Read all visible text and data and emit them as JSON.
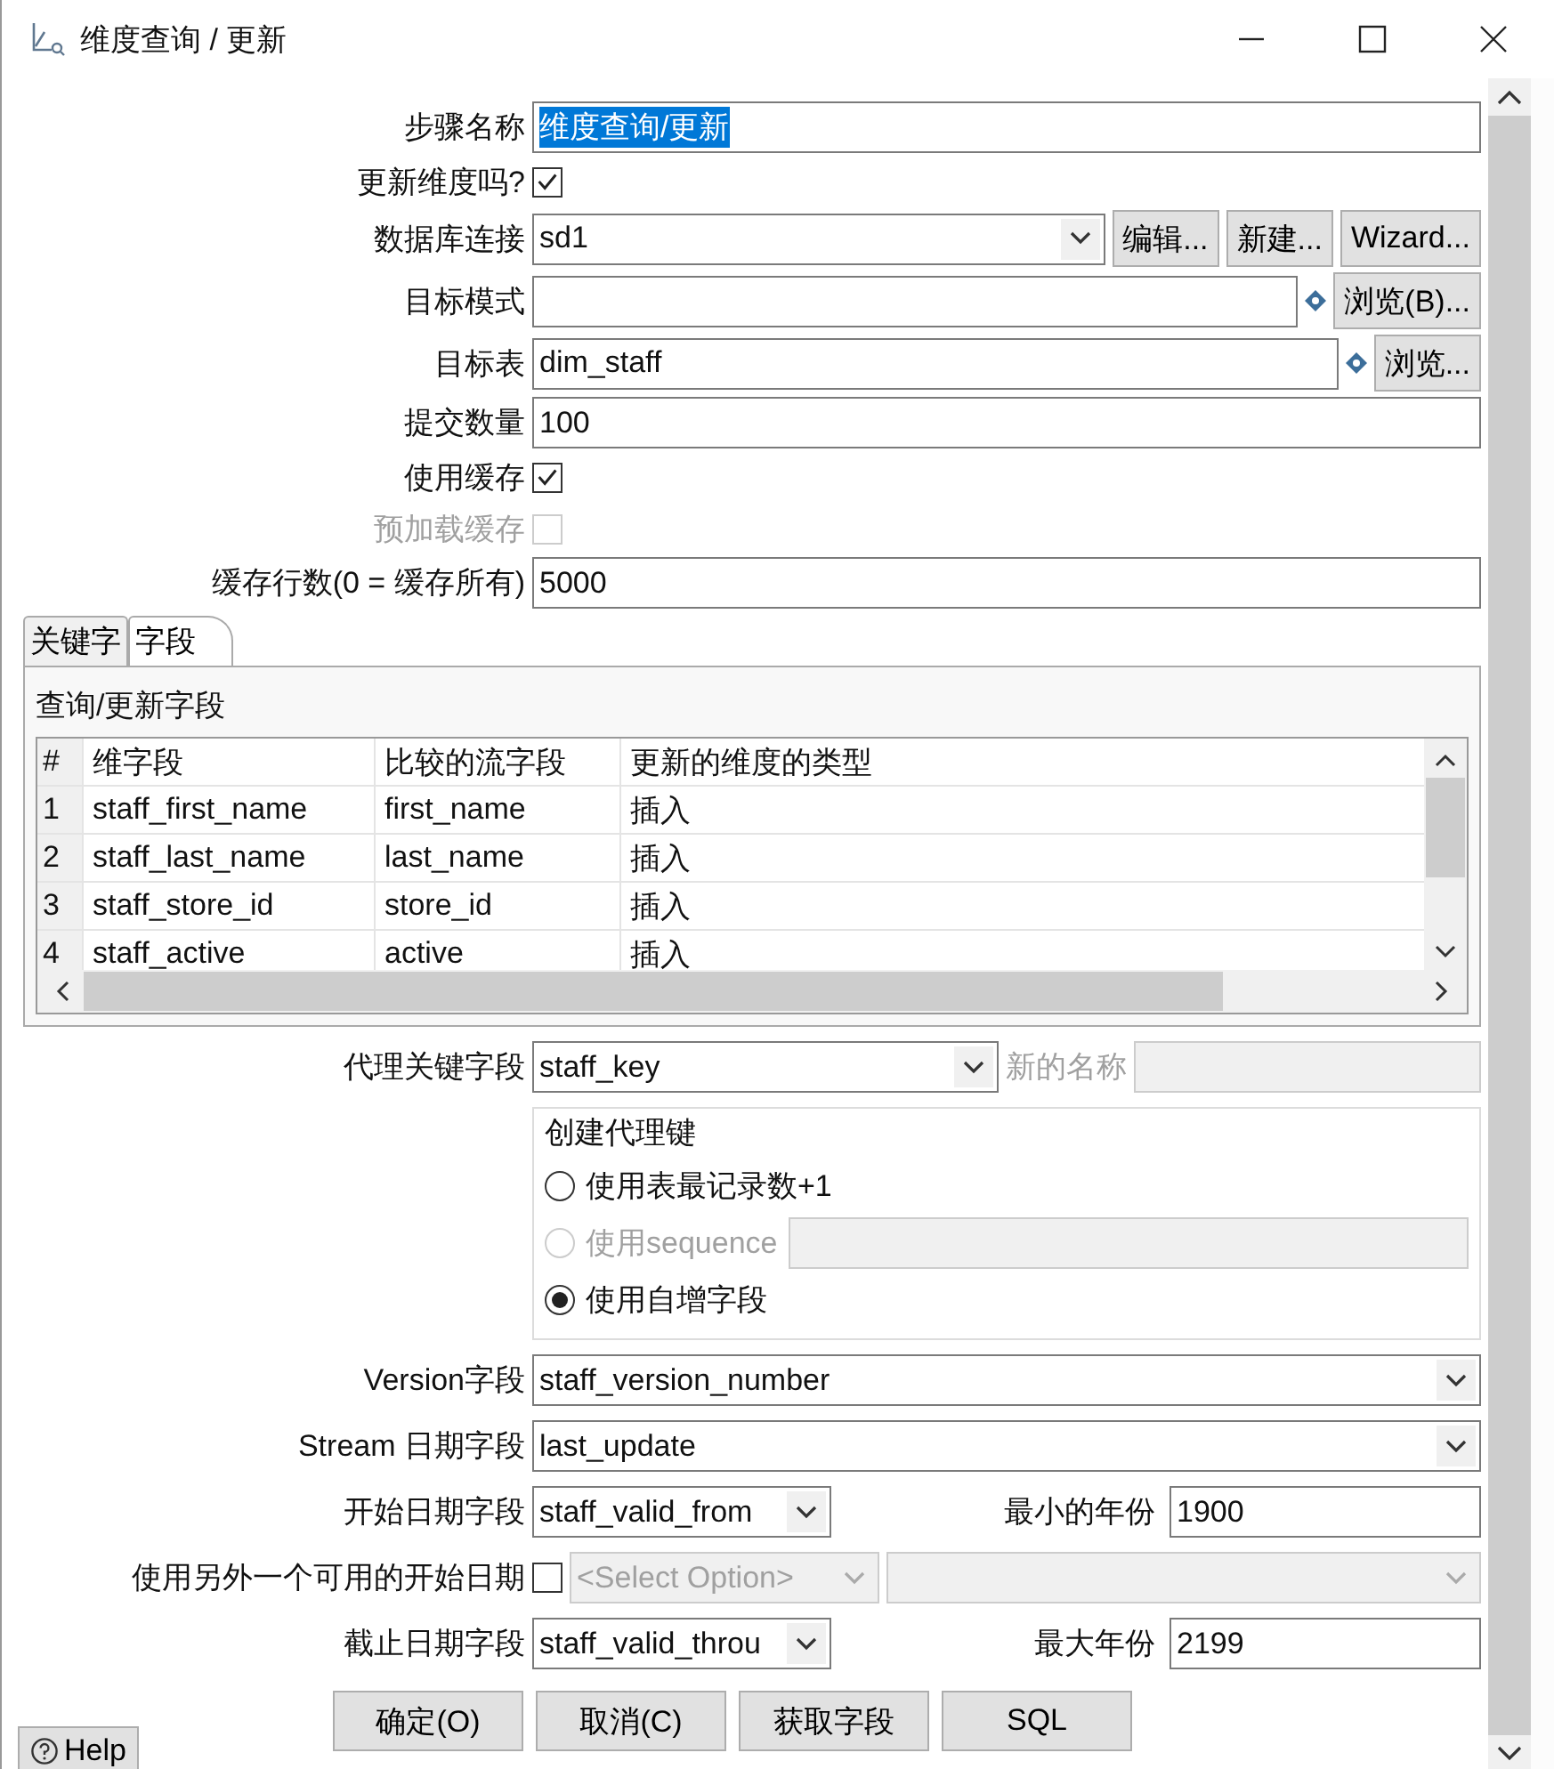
{
  "window": {
    "title": "维度查询 / 更新"
  },
  "fields": [
    {
      "kind": "text",
      "label": "步骤名称",
      "value": "维度查询/更新",
      "value_selected": true
    },
    {
      "kind": "checkbox",
      "label": "更新维度吗?",
      "checked": true,
      "disabled": false
    },
    {
      "kind": "select",
      "label": "数据库连接",
      "value": "sd1",
      "buttons": [
        "编辑...",
        "新建...",
        "Wizard..."
      ]
    },
    {
      "kind": "variable",
      "label": "目标模式",
      "buttons": [
        "浏览(B)..."
      ]
    },
    {
      "kind": "variable",
      "label": "目标表",
      "value": "dim_staff",
      "buttons": [
        "浏览..."
      ]
    },
    {
      "kind": "text",
      "label": "提交数量",
      "value": "100"
    },
    {
      "kind": "checkbox",
      "label": "使用缓存",
      "checked": true,
      "disabled": false
    },
    {
      "kind": "checkbox",
      "label": "预加载缓存",
      "checked": false,
      "disabled": true
    },
    {
      "kind": "text",
      "label": "缓存行数(0 = 缓存所有)",
      "value": "5000"
    }
  ],
  "tabs": [
    {
      "label": "关键字",
      "selected": false
    },
    {
      "label": "字段",
      "selected": true
    }
  ],
  "table": {
    "title": "查询/更新字段",
    "columns": [
      "#",
      "维字段",
      "比较的流字段",
      "更新的维度的类型"
    ],
    "rows": [
      [
        "1",
        "staff_first_name",
        "first_name",
        "插入"
      ],
      [
        "2",
        "staff_last_name",
        "last_name",
        "插入"
      ],
      [
        "3",
        "staff_store_id",
        "store_id",
        "插入"
      ],
      [
        "4",
        "staff_active",
        "active",
        "插入"
      ]
    ]
  },
  "surrogate": {
    "label": "代理关键字段",
    "value": "staff_key",
    "new_name_label": "新的名称",
    "new_name_disabled": true
  },
  "key_group": {
    "title": "创建代理键",
    "options": [
      {
        "label": "使用表最记录数+1",
        "selected": false,
        "disabled": false
      },
      {
        "label": "使用sequence",
        "selected": false,
        "disabled": true,
        "has_field": true
      },
      {
        "label": "使用自增字段",
        "selected": true,
        "disabled": false
      }
    ]
  },
  "version": {
    "label": "Version字段",
    "value": "staff_version_number"
  },
  "stream": {
    "label": "Stream 日期字段",
    "value": "last_update"
  },
  "start": {
    "label": "开始日期字段",
    "value": "staff_valid_from",
    "year_label": "最小的年份",
    "year": "1900"
  },
  "alt_start": {
    "label": "使用另外一个可用的开始日期",
    "checked": false,
    "select": "<Select Option>",
    "disabled": true
  },
  "end": {
    "label": "截止日期字段",
    "value": "staff_valid_throu",
    "year_label": "最大年份",
    "year": "2199"
  },
  "buttons": [
    "确定(O)",
    "取消(C)",
    "获取字段",
    "SQL"
  ],
  "help": "Help"
}
